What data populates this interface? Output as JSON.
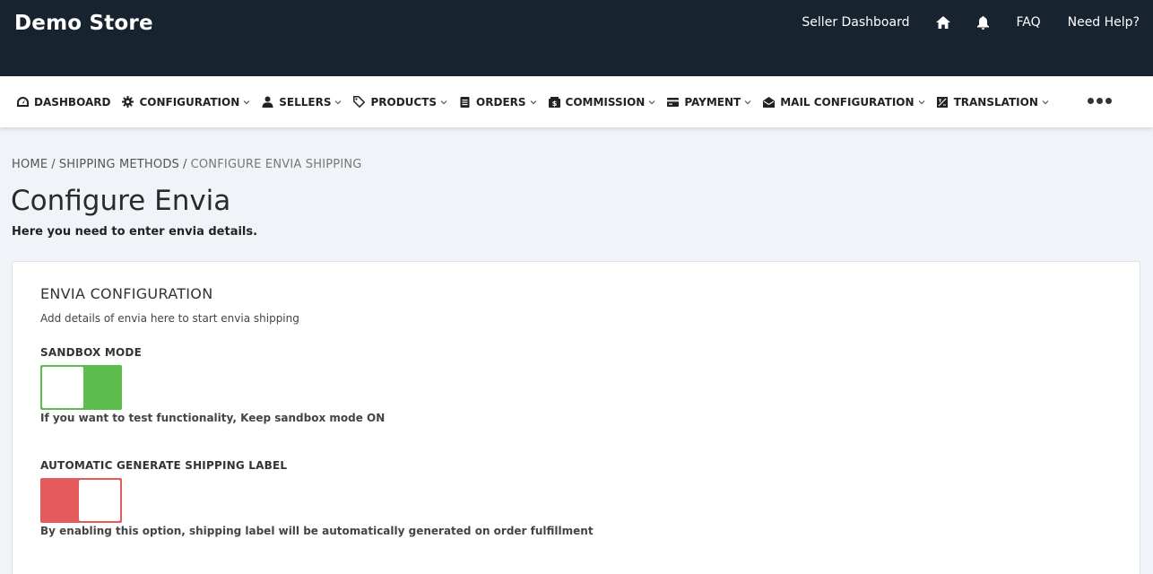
{
  "header": {
    "brand": "Demo Store",
    "links": {
      "seller_dashboard": "Seller Dashboard",
      "faq": "FAQ",
      "need_help": "Need Help?"
    },
    "icons": [
      "home-icon",
      "bell-icon"
    ]
  },
  "nav": {
    "items": [
      {
        "label": "DASHBOARD",
        "icon": "dashboard-icon",
        "has_dropdown": false
      },
      {
        "label": "CONFIGURATION",
        "icon": "gear-icon",
        "has_dropdown": true
      },
      {
        "label": "SELLERS",
        "icon": "users-icon",
        "has_dropdown": true
      },
      {
        "label": "PRODUCTS",
        "icon": "tags-icon",
        "has_dropdown": true
      },
      {
        "label": "ORDERS",
        "icon": "clipboard-icon",
        "has_dropdown": true
      },
      {
        "label": "COMMISSION",
        "icon": "money-icon",
        "has_dropdown": true
      },
      {
        "label": "PAYMENT",
        "icon": "credit-card-icon",
        "has_dropdown": true
      },
      {
        "label": "MAIL CONFIGURATION",
        "icon": "envelope-open-icon",
        "has_dropdown": true
      },
      {
        "label": "TRANSLATION",
        "icon": "translate-icon",
        "has_dropdown": true
      }
    ],
    "more_icon": "more-dots-icon"
  },
  "breadcrumb": {
    "home": "HOME",
    "shipping": "SHIPPING METHODS",
    "current": "CONFIGURE ENVIA SHIPPING",
    "separator": "/"
  },
  "page": {
    "title": "Configure Envia",
    "subtitle": "Here you need to enter envia details."
  },
  "card": {
    "title": "ENVIA CONFIGURATION",
    "description": "Add details of envia here to start envia shipping",
    "fields": [
      {
        "label": "SANDBOX MODE",
        "state": "on",
        "help": "If you want to test functionality, Keep sandbox mode ON"
      },
      {
        "label": "AUTOMATIC GENERATE SHIPPING LABEL",
        "state": "off",
        "help": "By enabling this option, shipping label will be automatically generated on order fulfillment"
      }
    ]
  },
  "colors": {
    "header_bg": "#17232e",
    "toggle_on": "#5cbd4d",
    "toggle_off": "#e55a5a",
    "page_bg": "#f0f3f7"
  }
}
